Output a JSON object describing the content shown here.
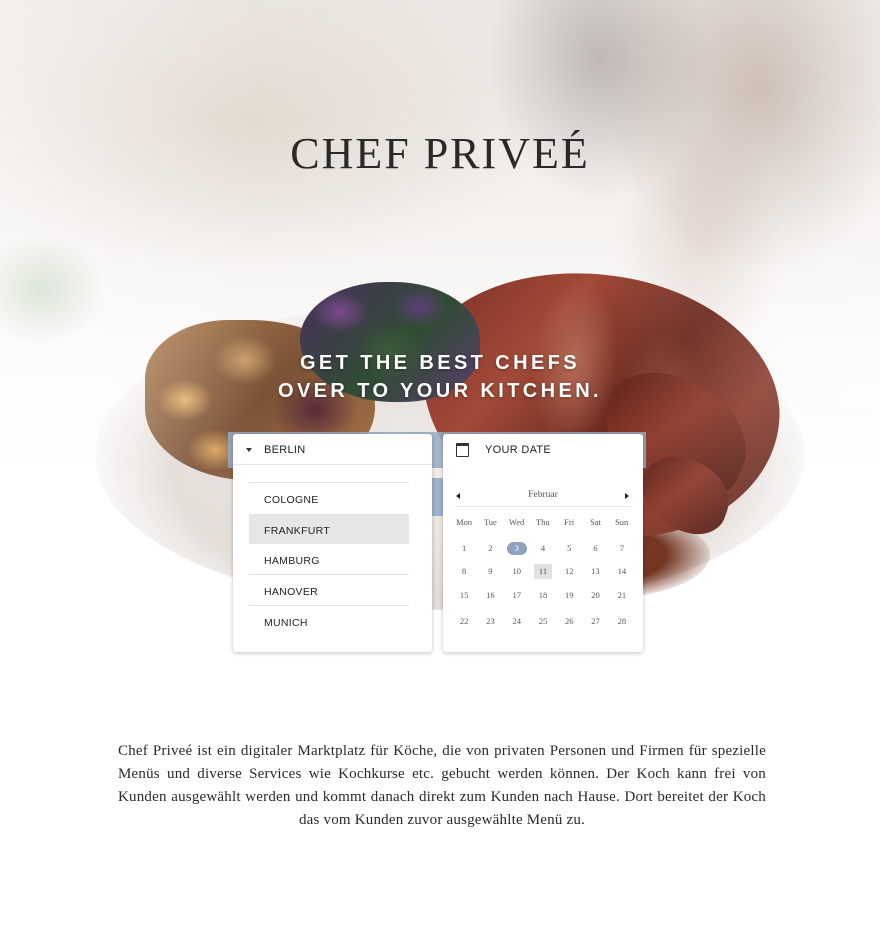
{
  "brand": {
    "title": "CHEF PRIVEÉ"
  },
  "hero": {
    "tagline_line1": "GET THE BEST CHEFS",
    "tagline_line2": "OVER TO YOUR KITCHEN."
  },
  "city_select": {
    "selected": "BERLIN",
    "icon": "caret-down-icon",
    "options": [
      "COLOGNE",
      "FRANKFURT",
      "HAMBURG",
      "HANOVER",
      "MUNICH"
    ],
    "highlighted": "FRANKFURT"
  },
  "date_picker": {
    "label": "YOUR DATE",
    "icon": "calendar-icon",
    "month": "Februar",
    "weekdays": [
      "Mon",
      "Tue",
      "Wed",
      "Thu",
      "Fri",
      "Sat",
      "Sun"
    ],
    "weeks": [
      [
        "1",
        "2",
        "3",
        "4",
        "5",
        "6",
        "7"
      ],
      [
        "8",
        "9",
        "10",
        "11",
        "12",
        "13",
        "14"
      ],
      [
        "15",
        "16",
        "17",
        "18",
        "19",
        "20",
        "21"
      ],
      [
        "22",
        "23",
        "24",
        "25",
        "26",
        "27",
        "28"
      ]
    ],
    "selected_day": "3",
    "hovered_day": "11",
    "accent_color": "#8ea1bd"
  },
  "description": "Chef Priveé ist ein digitaler Marktplatz für Köche, die von privaten Personen und Firmen für spezielle Menüs und diverse Services wie Kochkurse etc. gebucht werden können. Der Koch kann frei von Kunden ausgewählt werden und kommt danach direkt zum Kunden nach Hause.  Dort bereitet der Koch das vom Kunden zuvor ausgewählte Menü zu."
}
